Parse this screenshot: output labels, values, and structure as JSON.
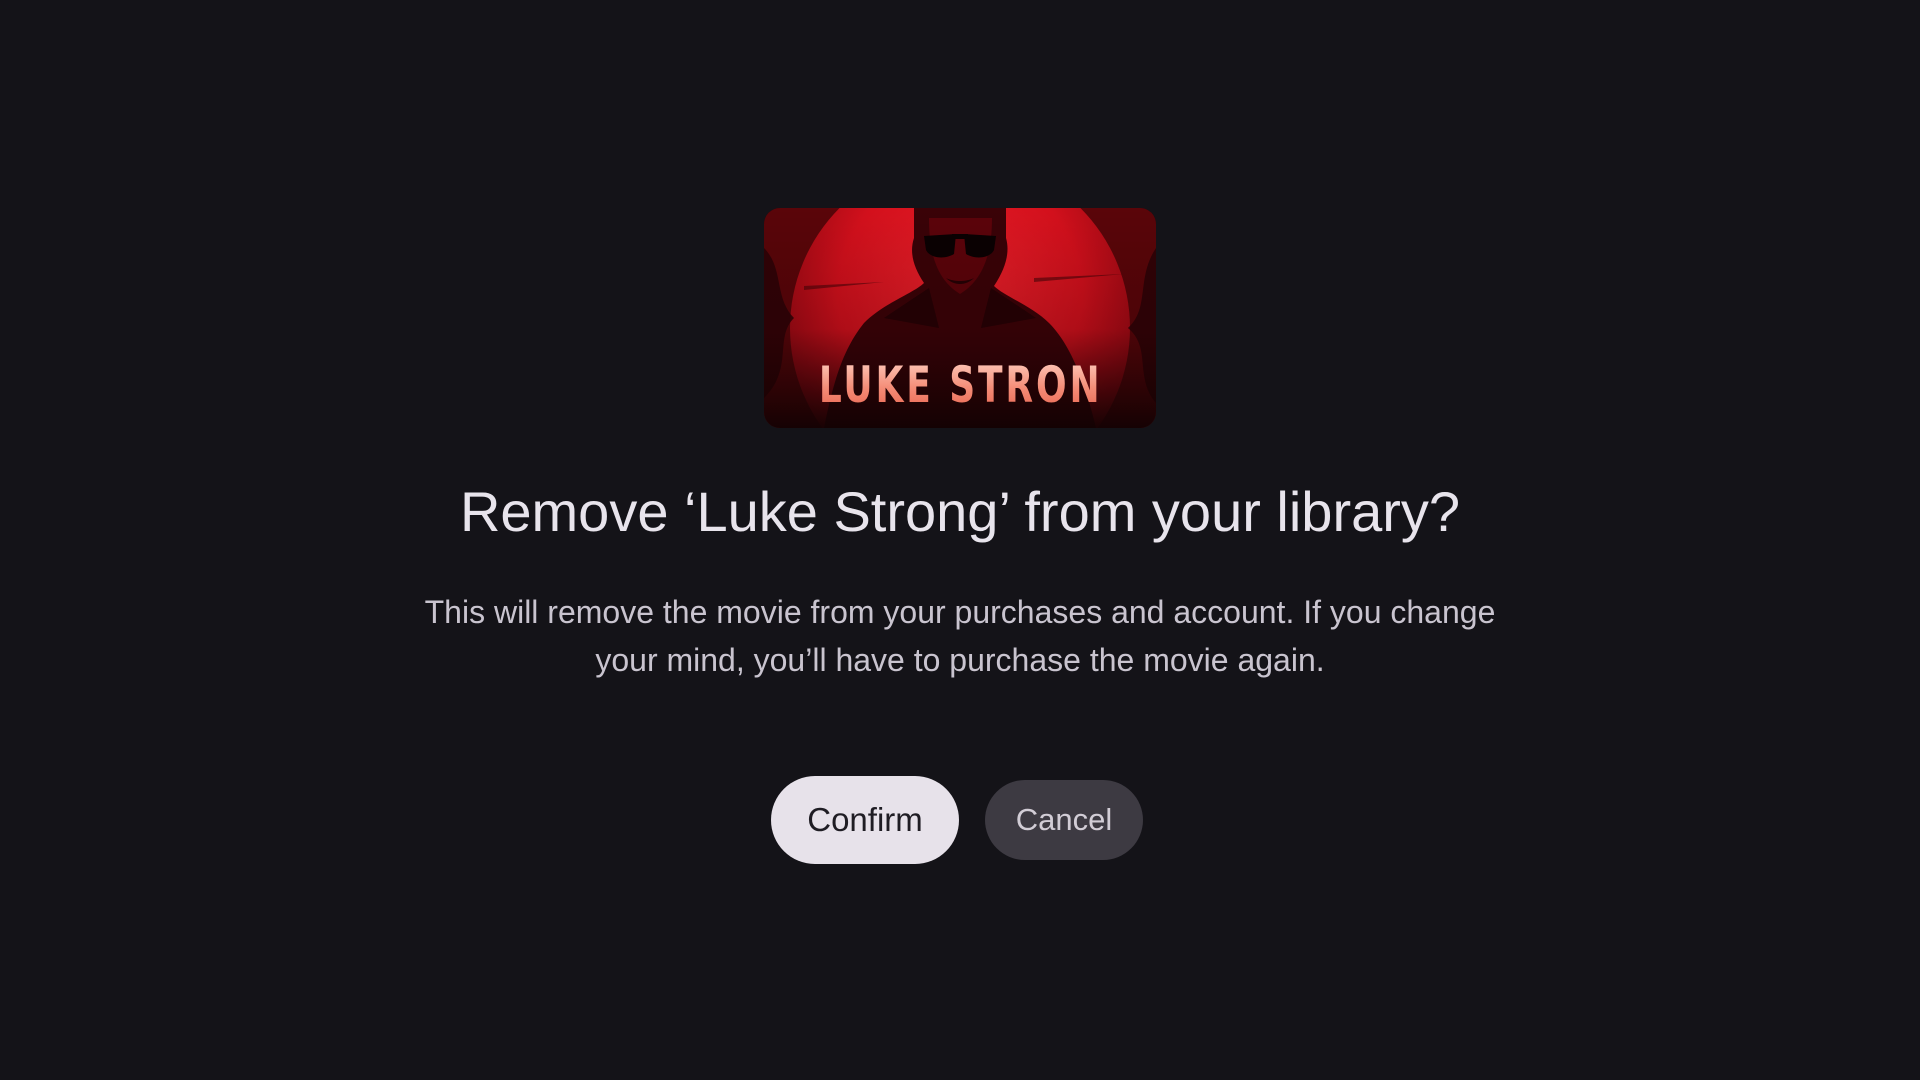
{
  "poster": {
    "title_text": "LUKE STRONG",
    "image_description_icon": "movie-poster-icon"
  },
  "dialog": {
    "title": "Remove ‘Luke Strong’ from your library?",
    "body": "This will remove the movie from your purchases and account. If you change your mind, you’ll have to purchase the movie again."
  },
  "actions": {
    "confirm_label": "Confirm",
    "cancel_label": "Cancel"
  },
  "colors": {
    "background": "#141318",
    "confirm_bg": "#e7e2ea",
    "cancel_bg": "#3d3a42",
    "poster_red": "#d8121f"
  }
}
